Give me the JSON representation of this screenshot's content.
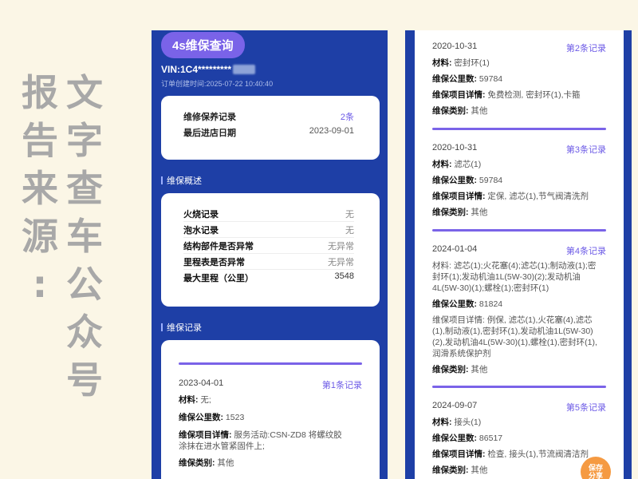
{
  "caption": {
    "left_col": [
      "文",
      "字",
      "查",
      "车",
      "公",
      "众",
      "号"
    ],
    "right_col": [
      "报",
      "告",
      "来",
      "源",
      ":"
    ]
  },
  "panel1": {
    "badge": "4s维保查询",
    "vin": "VIN:1C4*********",
    "order_time": "订单创建时间:2025-07-22 10:40:40",
    "summary": [
      {
        "label": "维修保养记录",
        "value": "2条"
      },
      {
        "label": "最后进店日期",
        "value": "2023-09-01"
      }
    ],
    "overview_title": "维保概述",
    "overview": [
      {
        "label": "火烧记录",
        "value": "无"
      },
      {
        "label": "泡水记录",
        "value": "无"
      },
      {
        "label": "结构部件是否异常",
        "value": "无异常"
      },
      {
        "label": "里程表是否异常",
        "value": "无异常"
      },
      {
        "label": "最大里程（公里）",
        "value": "3548"
      }
    ],
    "records_title": "维保记录",
    "record1": {
      "date": "2023-04-01",
      "index": "第1条记录",
      "material_label": "材料:",
      "material": "无;",
      "mileage_label": "维保公里数:",
      "mileage": "1523",
      "detail_label": "维保项目详情:",
      "detail_line1": "服务活动:CSN-ZD8 将螺纹胶",
      "detail_line2": "涂抹在进水管紧固件上;",
      "type_label": "维保类别:",
      "type": "其他"
    }
  },
  "panel2": {
    "records": [
      {
        "date": "2020-10-31",
        "index": "第2条记录",
        "material": "密封环(1)",
        "mileage": "59784",
        "detail": "免费检测, 密封环(1),卡箍",
        "type": "其他"
      },
      {
        "date": "2020-10-31",
        "index": "第3条记录",
        "material": "滤芯(1)",
        "mileage": "59784",
        "detail": "定保, 滤芯(1),节气阀清洗剂",
        "type": "其他"
      },
      {
        "date": "2024-01-04",
        "index": "第4条记录",
        "material_lines": [
          "材料: 滤芯(1);火花塞(4);滤芯(1);制动液(1);密",
          "封环(1);发动机油1L(5W-30)(2);发动机油",
          "4L(5W-30)(1);螺栓(1);密封环(1)"
        ],
        "mileage": "81824",
        "detail_lines": [
          "维保项目详情: 例保, 滤芯(1),火花塞(4),滤芯",
          "(1),制动液(1),密封环(1),发动机油1L(5W-30)",
          "(2),发动机油4L(5W-30)(1),螺栓(1),密封环(1),",
          "润滑系统保护剂"
        ],
        "type": "其他"
      },
      {
        "date": "2024-09-07",
        "index": "第5条记录",
        "material": "接头(1)",
        "mileage": "86517",
        "detail": "检查, 接头(1),节流阀清洁剂",
        "type": "其他"
      }
    ],
    "labels": {
      "material": "材料:",
      "mileage": "维保公里数:",
      "detail": "维保项目详情:",
      "type": "维保类别:"
    }
  },
  "fab": {
    "line1": "保存",
    "line2": "分享"
  },
  "colors": {
    "page_bg": "#fbf6e6",
    "panel_bg": "#1e3fa6",
    "accent": "#7a63e8",
    "fab": "#f59a42"
  }
}
